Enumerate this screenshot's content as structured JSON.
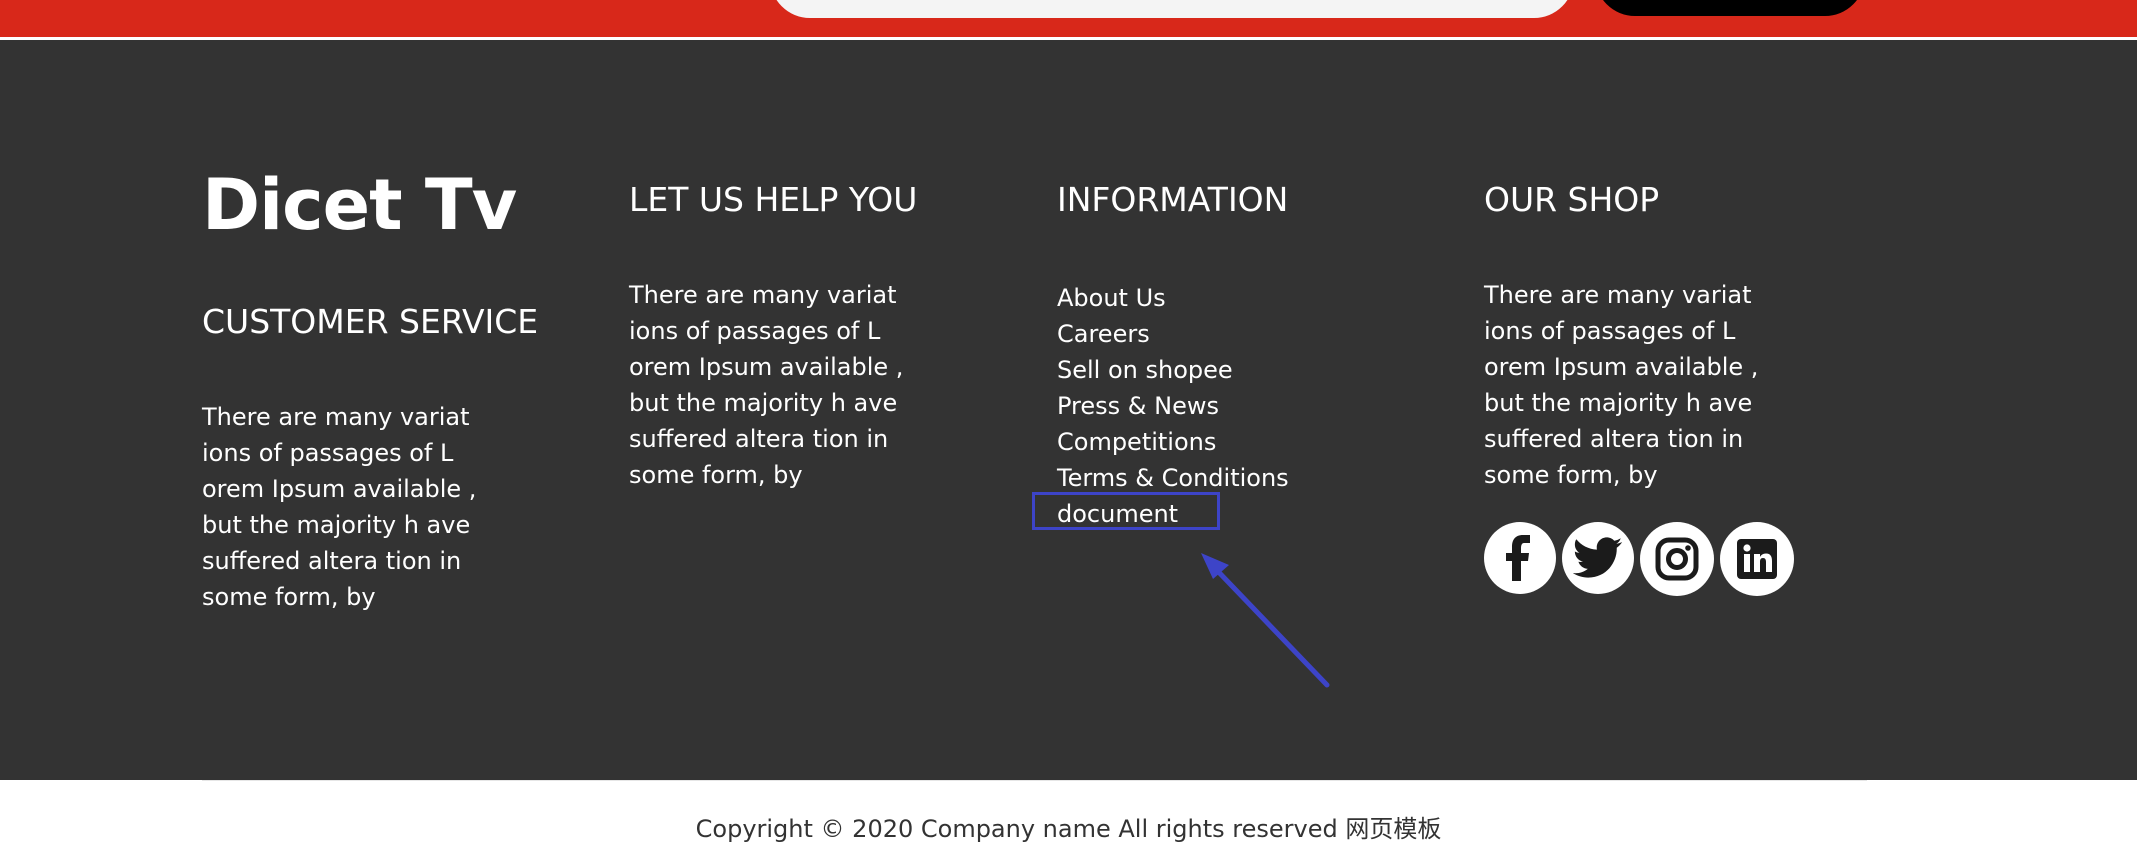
{
  "footer": {
    "logo": "Dicet Tv",
    "customer_service": {
      "heading": "CUSTOMER SERVICE",
      "text": "There are many variat\nions of passages of L\norem Ipsum available ,\nbut the majority h ave\nsuffered altera tion in\nsome form, by"
    },
    "help": {
      "heading": "LET US HELP YOU",
      "text": "There are many variat\nions of passages of L\norem Ipsum available ,\nbut the majority h ave\nsuffered altera tion in\nsome form, by"
    },
    "information": {
      "heading": "INFORMATION",
      "links": [
        "About Us",
        "Careers",
        "Sell on shopee",
        "Press & News",
        "Competitions",
        "Terms & Conditions",
        "document"
      ]
    },
    "shop": {
      "heading": "OUR SHOP",
      "text": "There are many variat\nions of passages of L\norem Ipsum available ,\nbut the majority h ave\nsuffered altera tion in\nsome form, by",
      "social": [
        "facebook-icon",
        "twitter-icon",
        "instagram-icon",
        "linkedin-icon"
      ]
    }
  },
  "copyright": "Copyright © 2020 Company name All rights reserved 网页模板",
  "colors": {
    "top_band": "#d8281a",
    "footer_bg": "#333333",
    "highlight": "#3d44c8"
  }
}
